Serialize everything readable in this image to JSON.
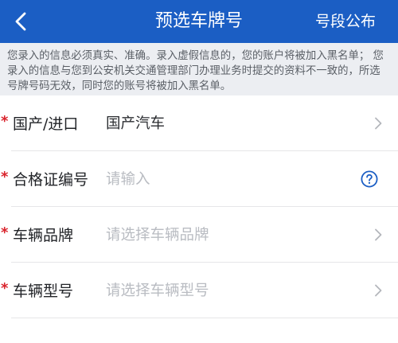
{
  "navbar": {
    "title": "预选车牌号",
    "right_action": "号段公布",
    "back_icon": "back-chevron-icon",
    "color": "#1b5ec4"
  },
  "notice": {
    "text": "您录入的信息必须真实、准确。录入虚假信息的，您的账户将被加入黑名单； 您录入的信息与您到公安机关交通管理部门办理业务时提交的资料不一致的，所选号牌号码无效，同时您的账号将被加入黑名单。"
  },
  "form": {
    "fields": [
      {
        "label": "国产/进口",
        "value": "国产汽车",
        "placeholder": "",
        "required": true,
        "trailing_icon": "chevron-right-icon"
      },
      {
        "label": "合格证编号",
        "value": "",
        "placeholder": "请输入",
        "required": true,
        "trailing_icon": "help-circle-icon"
      },
      {
        "label": "车辆品牌",
        "value": "",
        "placeholder": "请选择车辆品牌",
        "required": true,
        "trailing_icon": "chevron-right-icon"
      },
      {
        "label": "车辆型号",
        "value": "",
        "placeholder": "请选择车辆型号",
        "required": true,
        "trailing_icon": "chevron-right-icon"
      }
    ],
    "required_mark": "*",
    "required_color": "#d9232c"
  }
}
